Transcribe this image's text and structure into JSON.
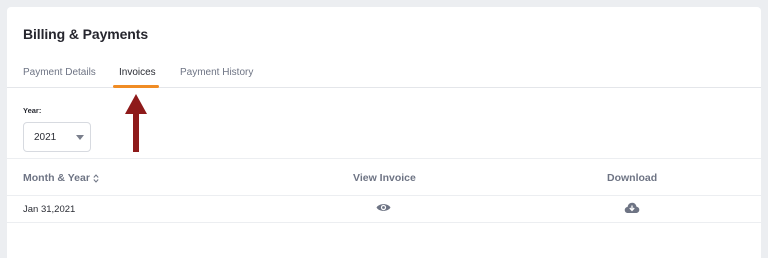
{
  "header": {
    "title": "Billing & Payments"
  },
  "tabs": [
    {
      "label": "Payment Details",
      "active": false
    },
    {
      "label": "Invoices",
      "active": true
    },
    {
      "label": "Payment History",
      "active": false
    }
  ],
  "filter": {
    "year_label": "Year:",
    "year_value": "2021"
  },
  "table": {
    "columns": [
      "Month & Year",
      "View Invoice",
      "Download"
    ],
    "rows": [
      {
        "month_year": "Jan 31,2021",
        "view_icon": "eye-icon",
        "download_icon": "cloud-download-icon"
      }
    ]
  },
  "colors": {
    "accent": "#f08c24",
    "annotation_arrow": "#8e1a1a",
    "header_text": "#6e7484",
    "body_text": "#2a2c34"
  },
  "icons": [
    "sort-icon",
    "chevron-down-icon",
    "eye-icon",
    "cloud-download-icon",
    "arrow-up-icon"
  ]
}
